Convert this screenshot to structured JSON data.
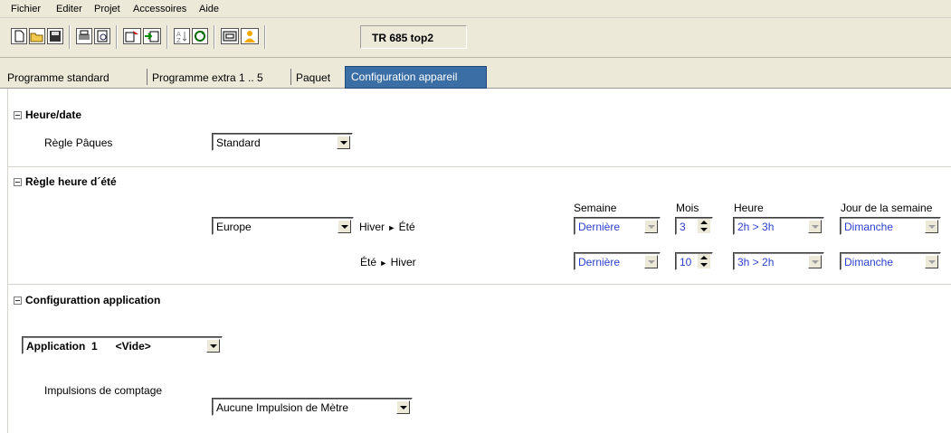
{
  "menu": [
    "Fichier",
    "Editer",
    "Projet",
    "Accessoires",
    "Aide"
  ],
  "toolbar": {
    "device": "TR 685 top2",
    "icons": [
      "new-file-icon",
      "open-folder-icon",
      "save-icon",
      "print-icon",
      "print-preview-icon",
      "export-icon",
      "import-icon",
      "sort-icon",
      "refresh-icon",
      "device-icon",
      "user-icon"
    ]
  },
  "tabs": [
    "Programme standard",
    "Programme extra 1 .. 5",
    "Paquet",
    "Configuration appareil"
  ],
  "active_tab": "Configuration appareil",
  "sections": {
    "heure_date": {
      "title": "Heure/date",
      "regle_paques_label": "Règle Pâques",
      "regle_paques_value": "Standard"
    },
    "heure_ete": {
      "title": "Règle heure d´été",
      "region": "Europe",
      "headers": {
        "semaine": "Semaine",
        "mois": "Mois",
        "heure": "Heure",
        "jour": "Jour de la semaine"
      },
      "rows": [
        {
          "from": "Hiver",
          "arrow": "►",
          "to": "Été",
          "semaine": "Dernière",
          "mois": "3",
          "heure": "2h > 3h",
          "jour": "Dimanche"
        },
        {
          "from": "Été",
          "arrow": "►",
          "to": "Hiver",
          "semaine": "Dernière",
          "mois": "10",
          "heure": "3h > 2h",
          "jour": "Dimanche"
        }
      ]
    },
    "application": {
      "title": "Configurattion application",
      "selector": "Application  1      <Vide>",
      "impulsions_label": "Impulsions de comptage",
      "impulsions_value": "Aucune Impulsion de Mètre"
    }
  }
}
